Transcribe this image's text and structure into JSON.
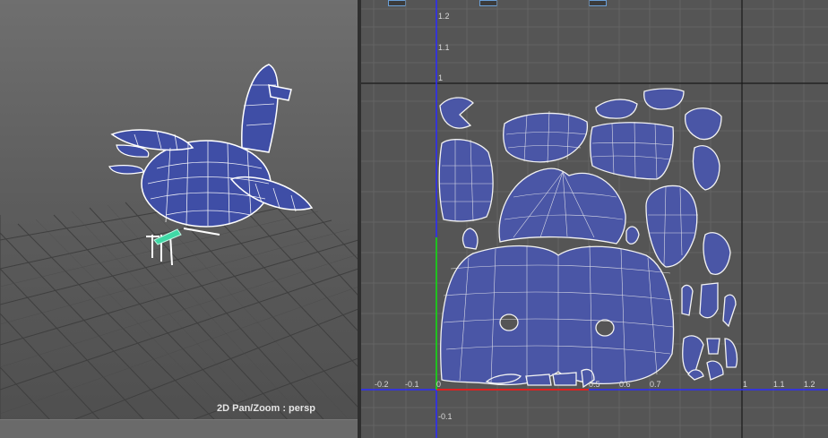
{
  "persp_view": {
    "hud_label": "2D Pan/Zoom : persp"
  },
  "uv_editor": {
    "x_ticks": [
      "-0.2",
      "-0.1",
      "0",
      "0.5",
      "0.6",
      "0.7",
      "1",
      "1.1",
      "1.2"
    ],
    "y_ticks": [
      "1.2",
      "1.1",
      "1",
      "-0.1"
    ],
    "colors": {
      "uv_shell_fill": "#4a56a6",
      "axis_blue": "#2b2bff",
      "axis_red": "#e02020",
      "axis_green": "#20c020"
    }
  }
}
